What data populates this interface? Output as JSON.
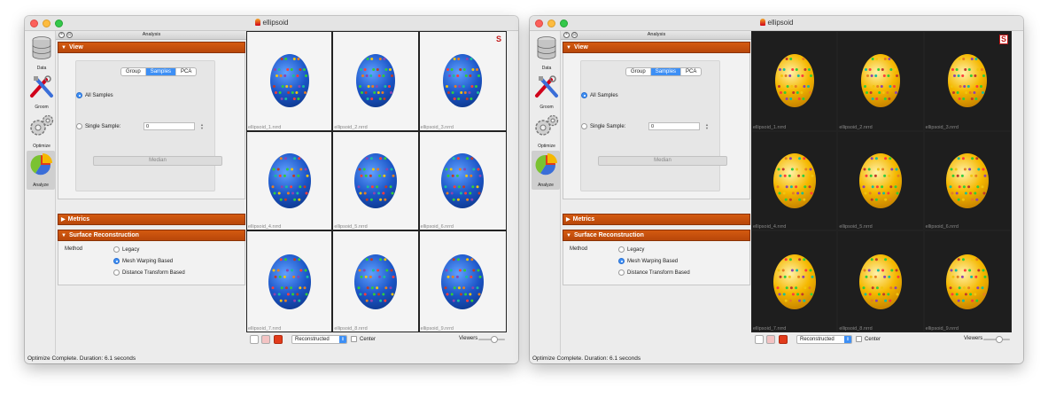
{
  "windows": [
    {
      "theme": "light",
      "title": "ellipsoid",
      "toolbar": [
        {
          "label": "Data",
          "icon": "database-icon"
        },
        {
          "label": "Groom",
          "icon": "tools-icon"
        },
        {
          "label": "Optimize",
          "icon": "gears-icon"
        },
        {
          "label": "Analyze",
          "icon": "pie-chart-icon",
          "selected": true
        }
      ],
      "panel": {
        "title": "Analysis",
        "view_section": "View",
        "tabs": [
          "Group",
          "Samples",
          "PCA"
        ],
        "active_tab": "Samples",
        "all_samples": "All Samples",
        "single_sample": "Single Sample:",
        "single_sample_value": "0",
        "median": "Median",
        "metrics_section": "Metrics",
        "surface_section": "Surface Reconstruction",
        "method_label": "Method",
        "methods": [
          "Legacy",
          "Mesh Warping Based",
          "Distance Transform Based"
        ],
        "selected_method": "Mesh Warping Based"
      },
      "viewer": {
        "captions": [
          "ellipsoid_1.nrrd",
          "ellipsoid_2.nrrd",
          "ellipsoid_3.nrrd",
          "ellipsoid_4.nrrd",
          "ellipsoid_5.nrrd",
          "ellipsoid_6.nrrd",
          "ellipsoid_7.nrrd",
          "ellipsoid_8.nrrd",
          "ellipsoid_9.nrrd"
        ],
        "logo": "S",
        "shape_color": "#1b55c7",
        "bg_color": "#f4f4f4"
      },
      "bottom": {
        "display_mode": "Reconstructed",
        "center_label": "Center",
        "viewers_label": "Viewers"
      },
      "status": "Optimize Complete.  Duration: 6.1 seconds"
    },
    {
      "theme": "dark",
      "title": "ellipsoid",
      "toolbar": [
        {
          "label": "Data",
          "icon": "database-icon"
        },
        {
          "label": "Groom",
          "icon": "tools-icon"
        },
        {
          "label": "Optimize",
          "icon": "gears-icon"
        },
        {
          "label": "Analyze",
          "icon": "pie-chart-icon",
          "selected": true
        }
      ],
      "panel": {
        "title": "Analysis",
        "view_section": "View",
        "tabs": [
          "Group",
          "Samples",
          "PCA"
        ],
        "active_tab": "Samples",
        "all_samples": "All Samples",
        "single_sample": "Single Sample:",
        "single_sample_value": "0",
        "median": "Median",
        "metrics_section": "Metrics",
        "surface_section": "Surface Reconstruction",
        "method_label": "Method",
        "methods": [
          "Legacy",
          "Mesh Warping Based",
          "Distance Transform Based"
        ],
        "selected_method": "Mesh Warping Based"
      },
      "viewer": {
        "captions": [
          "ellipsoid_1.nrrd",
          "ellipsoid_2.nrrd",
          "ellipsoid_3.nrrd",
          "ellipsoid_4.nrrd",
          "ellipsoid_5.nrrd",
          "ellipsoid_6.nrrd",
          "ellipsoid_7.nrrd",
          "ellipsoid_8.nrrd",
          "ellipsoid_9.nrrd"
        ],
        "logo": "S",
        "shape_color": "#f5b800",
        "bg_color": "#1e1e1e"
      },
      "bottom": {
        "display_mode": "Reconstructed",
        "center_label": "Center",
        "viewers_label": "Viewers"
      },
      "status": "Optimize Complete.  Duration: 6.1 seconds"
    }
  ]
}
